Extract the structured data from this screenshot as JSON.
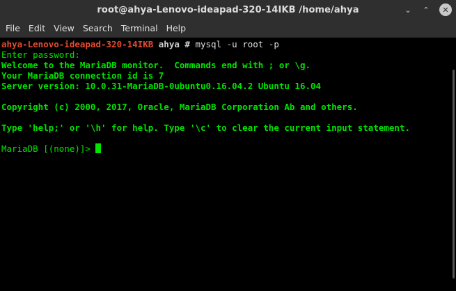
{
  "window": {
    "title": "root@ahya-Lenovo-ideapad-320-14IKB /home/ahya",
    "minimize_glyph": "⌄",
    "maximize_glyph": "⌃",
    "close_glyph": "✕"
  },
  "menu": {
    "items": [
      "File",
      "Edit",
      "View",
      "Search",
      "Terminal",
      "Help"
    ]
  },
  "terminal": {
    "prompt_host": "ahya-Lenovo-ideapad-320-14IKB",
    "prompt_dir": "ahya",
    "prompt_symbol": "#",
    "command": "mysql -u root -p",
    "lines": [
      "Enter password:",
      "Welcome to the MariaDB monitor.  Commands end with ; or \\g.",
      "Your MariaDB connection id is 7",
      "Server version: 10.0.31-MariaDB-0ubuntu0.16.04.2 Ubuntu 16.04",
      "",
      "Copyright (c) 2000, 2017, Oracle, MariaDB Corporation Ab and others.",
      "",
      "Type 'help;' or '\\h' for help. Type '\\c' to clear the current input statement.",
      ""
    ],
    "mariadb_prompt": "MariaDB [(none)]> "
  },
  "colors": {
    "terminal_bg": "#000000",
    "text_green": "#00e400",
    "prompt_red": "#e34c2f",
    "chrome_bg": "#2f2f2f"
  }
}
